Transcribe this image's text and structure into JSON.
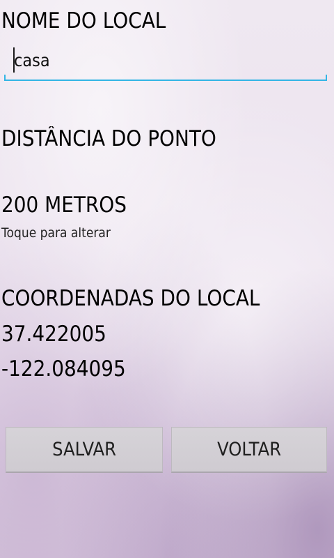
{
  "form": {
    "name_label": "NOME DO LOCAL",
    "name_value": "casa",
    "distance_label": "DISTÂNCIA DO PONTO",
    "distance_value": "200 METROS",
    "distance_hint": "Toque para alterar",
    "coordinates_label": "COORDENADAS DO LOCAL",
    "latitude": "37.422005",
    "longitude": "-122.084095"
  },
  "buttons": {
    "save_label": "SALVAR",
    "back_label": "VOLTAR"
  },
  "colors": {
    "accent": "#33b5e5",
    "button_bg": "#d3d0d5",
    "text": "#000000"
  }
}
